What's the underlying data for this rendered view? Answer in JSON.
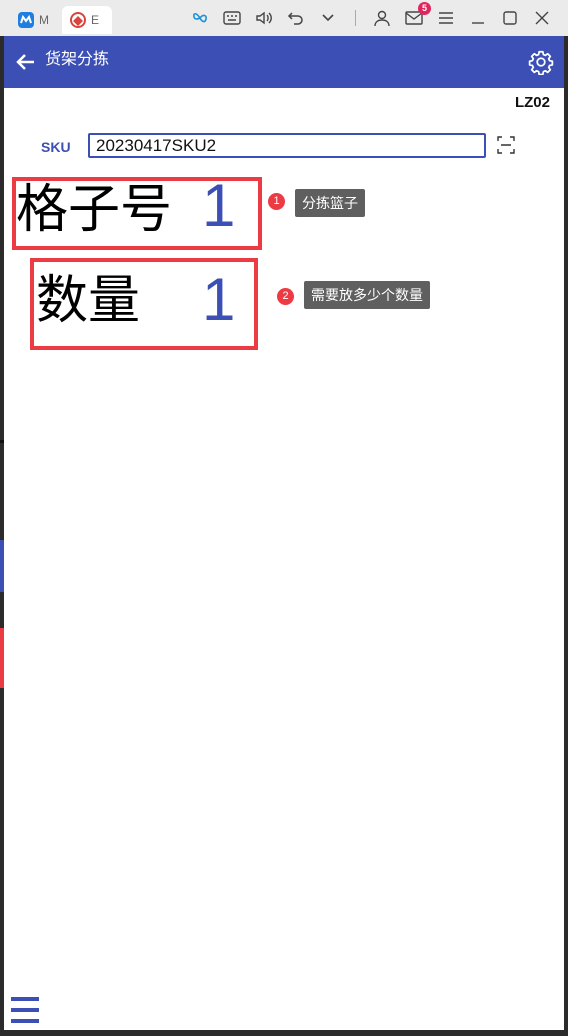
{
  "emulator": {
    "tabs": [
      {
        "label": "M",
        "icon": "app-m-icon",
        "color": "#1e7fe0"
      },
      {
        "label": "E",
        "icon": "app-e-icon",
        "color": "#d9453d"
      }
    ],
    "mail_badge": "5",
    "toolbar_icons": [
      "butterfly-icon",
      "keyboard-icon",
      "volume-icon",
      "undo-icon",
      "chevron-down-icon",
      "user-icon",
      "mail-icon",
      "menu-icon",
      "minimize-icon",
      "maximize-icon",
      "close-icon"
    ]
  },
  "appbar": {
    "title": "货架分拣",
    "back_icon": "arrow-left-icon",
    "settings_icon": "gear-icon"
  },
  "station": "LZ02",
  "sku": {
    "label": "SKU",
    "value": "20230417SKU2",
    "scan_icon": "scan-icon"
  },
  "slot": {
    "label": "格子号",
    "value": "1",
    "annotation_number": "1",
    "annotation_text": "分拣篮子"
  },
  "quantity": {
    "label": "数量",
    "value": "1",
    "annotation_number": "2",
    "annotation_text": "需要放多少个数量"
  },
  "colors": {
    "primary": "#3c4fb5",
    "highlight": "#ec3b43",
    "tooltip": "#5f5f5f"
  }
}
